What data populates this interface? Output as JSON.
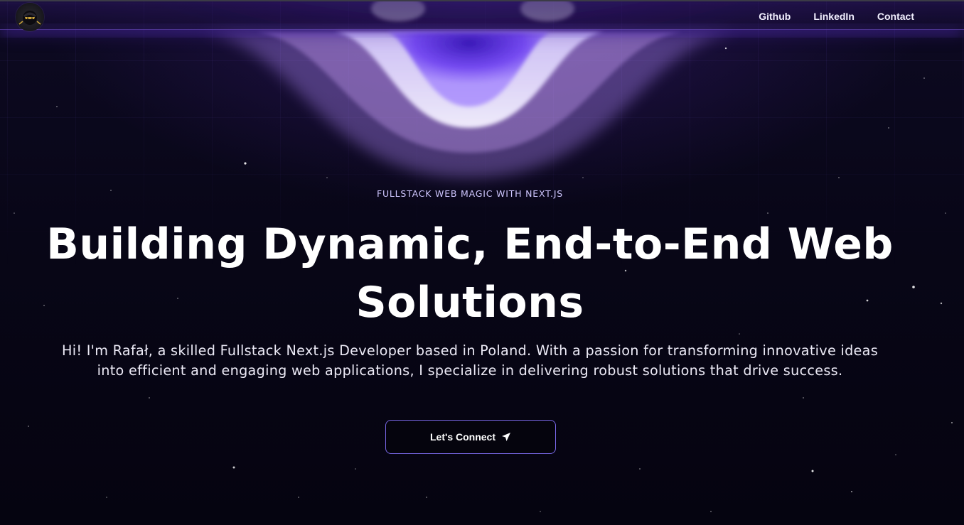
{
  "navbar": {
    "logo_alt": "Rafał logo",
    "links": [
      {
        "label": "Github"
      },
      {
        "label": "LinkedIn"
      },
      {
        "label": "Contact"
      }
    ]
  },
  "hero": {
    "eyebrow": "FULLSTACK WEB MAGIC WITH NEXT.JS",
    "headline_line1": "Building Dynamic, End-to-End Web",
    "headline_line2": "Solutions",
    "intro": "Hi! I'm Rafał, a skilled Fullstack Next.js Developer based in Poland. With a passion for transforming innovative ideas into efficient and engaging web applications, I specialize in delivering robust solutions that drive success.",
    "cta_label": "Let's Connect",
    "cta_icon": "send-arrow-icon"
  },
  "colors": {
    "background": "#06040f",
    "accent": "#7867e6",
    "glow": "#7c4dff",
    "text": "#ffffff"
  }
}
